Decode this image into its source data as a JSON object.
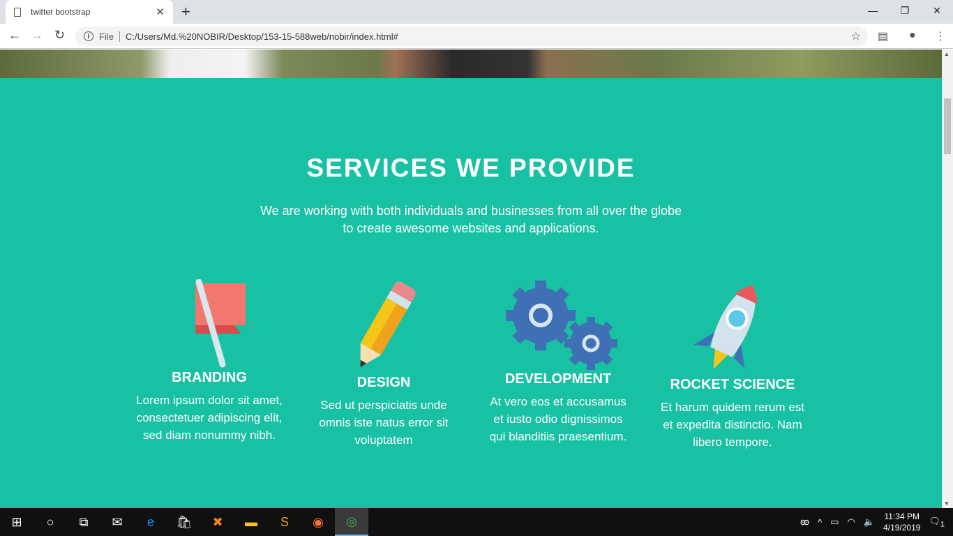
{
  "browser": {
    "tab_title": "twitter bootstrap",
    "url_prefix": "File",
    "url": "C:/Users/Md.%20NOBIR/Desktop/153-15-588web/nobir/index.html#"
  },
  "services": {
    "title": "SERVICES WE PROVIDE",
    "intro_line1": "We are working with both individuals and businesses from all over the globe",
    "intro_line2": "to create awesome websites and applications.",
    "items": [
      {
        "title": "BRANDING",
        "text": "Lorem ipsum dolor sit amet, consectetuer adipiscing elit, sed diam nonummy nibh.",
        "icon": "flag-icon"
      },
      {
        "title": "DESIGN",
        "text": "Sed ut perspiciatis unde omnis iste natus error sit voluptatem",
        "icon": "pencil-icon"
      },
      {
        "title": "DEVELOPMENT",
        "text": "At vero eos et accusamus et iusto odio dignissimos qui blanditiis praesentium.",
        "icon": "gears-icon"
      },
      {
        "title": "ROCKET SCIENCE",
        "text": "Et harum quidem rerum est et expedita distinctio. Nam libero tempore.",
        "icon": "rocket-icon"
      }
    ],
    "accent": "#18c1a3"
  },
  "taskbar": {
    "time": "11:34 PM",
    "date": "4/19/2019",
    "notifications": "1"
  }
}
